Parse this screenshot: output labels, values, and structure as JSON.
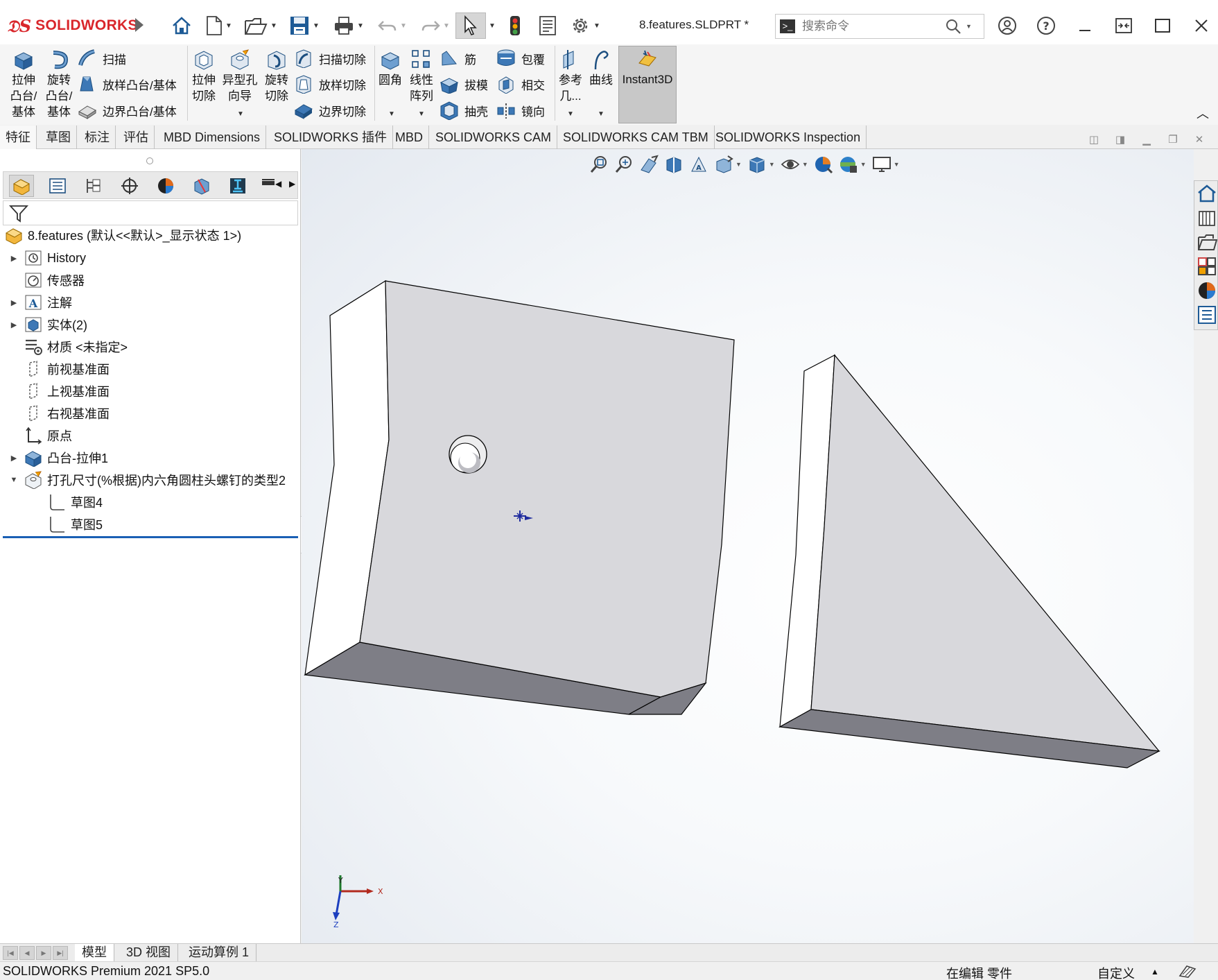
{
  "app": {
    "brand": "SOLIDWORKS",
    "document_title": "8.features.SLDPRT *",
    "search_placeholder": "搜索命令"
  },
  "ribbon": {
    "extrude_boss": "拉伸\n凸台/\n基体",
    "revolve_boss": "旋转\n凸台/\n基体",
    "sweep": "扫描",
    "loft_boss": "放样凸台/基体",
    "boundary_boss": "边界凸台/基体",
    "extrude_cut": "拉伸\n切除",
    "hole_wizard": "异型孔\n向导",
    "revolve_cut": "旋转\n切除",
    "swept_cut": "扫描切除",
    "lofted_cut": "放样切除",
    "boundary_cut": "边界切除",
    "fillet": "圆角",
    "linear_pattern": "线性\n阵列",
    "rib": "筋",
    "draft": "拔模",
    "shell": "抽壳",
    "wrap": "包覆",
    "intersect": "相交",
    "mirror": "镜向",
    "ref_geometry": "参考\n几...",
    "curves": "曲线",
    "instant3d": "Instant3D"
  },
  "command_tabs": [
    "特征",
    "草图",
    "标注",
    "评估",
    "MBD Dimensions",
    "SOLIDWORKS 插件",
    "MBD",
    "SOLIDWORKS CAM",
    "SOLIDWORKS CAM TBM",
    "SOLIDWORKS Inspection"
  ],
  "tree": {
    "root": "8.features  (默认<<默认>_显示状态 1>)",
    "items": [
      {
        "label": "History"
      },
      {
        "label": "传感器"
      },
      {
        "label": "注解"
      },
      {
        "label": "实体(2)"
      },
      {
        "label": "材质 <未指定>"
      },
      {
        "label": "前视基准面"
      },
      {
        "label": "上视基准面"
      },
      {
        "label": "右视基准面"
      },
      {
        "label": "原点"
      },
      {
        "label": "凸台-拉伸1"
      },
      {
        "label": "打孔尺寸(%根据)内六角圆柱头螺钉的类型2"
      },
      {
        "label": "草图4"
      },
      {
        "label": "草图5"
      }
    ]
  },
  "triad": {
    "x": "X",
    "y": "Y",
    "z": "Z"
  },
  "bottom_tabs": [
    "模型",
    "3D 视图",
    "运动算例 1"
  ],
  "status": {
    "product": "SOLIDWORKS Premium 2021 SP5.0",
    "editing": "在编辑 零件",
    "custom": "自定义"
  }
}
